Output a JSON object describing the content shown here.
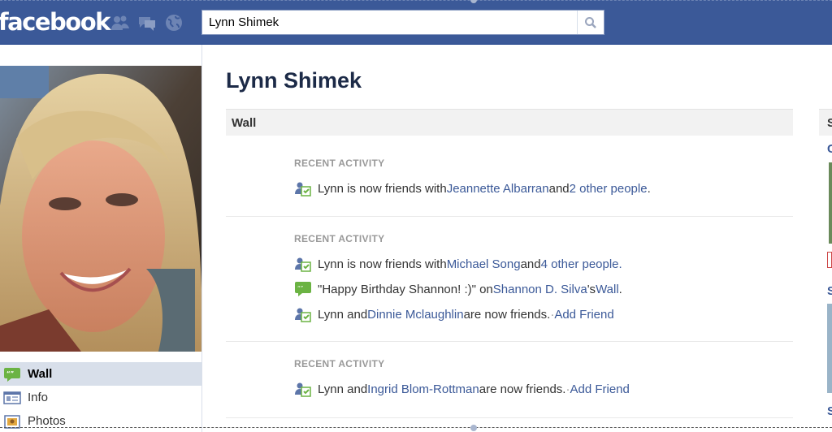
{
  "topbar": {
    "logo": "facebook",
    "jewels": [
      "friend-requests-icon",
      "messages-icon",
      "notifications-icon"
    ],
    "search": {
      "value": "Lynn Shimek",
      "icon": "search-icon"
    }
  },
  "profile": {
    "name": "Lynn Shimek"
  },
  "left_nav": {
    "items": [
      {
        "label": "Wall",
        "icon": "wall-icon",
        "active": true
      },
      {
        "label": "Info",
        "icon": "info-icon",
        "active": false
      },
      {
        "label": "Photos",
        "icon": "photos-icon",
        "active": false
      }
    ]
  },
  "wall": {
    "header": "Wall",
    "stories": [
      {
        "label": "RECENT ACTIVITY",
        "lines": [
          {
            "icon": "friends-icon",
            "p1": "Lynn is now friends with ",
            "link1": "Jeannette Albarran",
            "p2": " and ",
            "link2": "2 other people",
            "p3": "."
          }
        ]
      },
      {
        "label": "RECENT ACTIVITY",
        "lines": [
          {
            "icon": "friends-icon",
            "p1": "Lynn is now friends with ",
            "link1": "Michael Song",
            "p2": " and ",
            "link2": "4 other people.",
            "p3": ""
          },
          {
            "icon": "wall-post-icon",
            "p1": "\"Happy Birthday Shannon! :)\" on ",
            "link1": "Shannon D. Silva",
            "p2": "'s ",
            "link2": "Wall",
            "p3": "."
          },
          {
            "icon": "friends-icon",
            "p1": "Lynn and ",
            "link1": "Dinnie Mclaughlin",
            "p2": " are now friends.",
            "sep": " · ",
            "link2": "Add Friend",
            "p3": ""
          }
        ]
      },
      {
        "label": "RECENT ACTIVITY",
        "lines": [
          {
            "icon": "friends-icon",
            "p1": "Lynn and ",
            "link1": "Ingrid Blom-Rottman",
            "p2": " are now friends.",
            "sep": " · ",
            "link2": "Add Friend",
            "p3": ""
          }
        ]
      }
    ]
  },
  "right_col": {
    "header_initial": "S",
    "letters": [
      "C",
      "S",
      "S"
    ]
  },
  "colors": {
    "topbar": "#3b5998",
    "link": "#3b5998",
    "nav_active": "#d8dfea",
    "label_gray": "#999999"
  }
}
